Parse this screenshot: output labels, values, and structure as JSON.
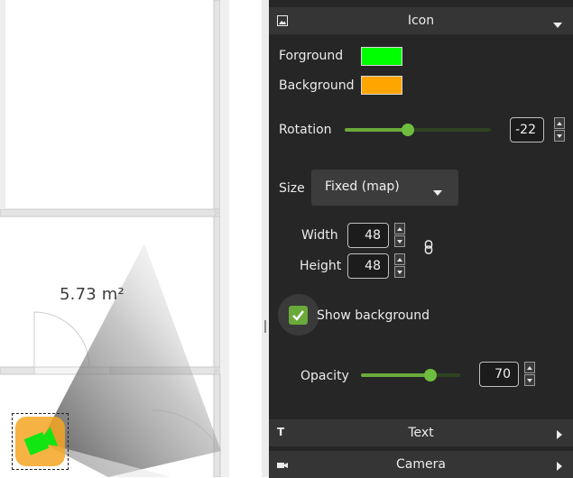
{
  "map": {
    "room_area": "5.73 m²",
    "icon_foreground_color": "#12e512",
    "icon_background_color": "#f5a623"
  },
  "panel": {
    "icon_section": {
      "title": "Icon",
      "header_icon": "image-icon",
      "expanded": true,
      "foreground": {
        "label": "Forground",
        "color": "#00ff00"
      },
      "background": {
        "label": "Background",
        "color": "#ffa500"
      },
      "rotation": {
        "label": "Rotation",
        "value": "-22",
        "slider_fraction": 0.43
      },
      "size": {
        "label": "Size",
        "mode": "Fixed (map)",
        "width": {
          "label": "Width",
          "value": "48"
        },
        "height": {
          "label": "Height",
          "value": "48"
        },
        "link_icon": "link-icon"
      },
      "show_background": {
        "label": "Show background",
        "checked": true
      },
      "opacity": {
        "label": "Opacity",
        "value": "70",
        "slider_fraction": 0.7
      }
    },
    "text_section": {
      "title": "Text",
      "header_icon": "text-icon",
      "expanded": false
    },
    "camera_section": {
      "title": "Camera",
      "header_icon": "camera-icon",
      "expanded": false
    }
  },
  "colors": {
    "panel_bg": "#262626",
    "header_bg": "#353535",
    "accent": "#6aaa3a"
  }
}
